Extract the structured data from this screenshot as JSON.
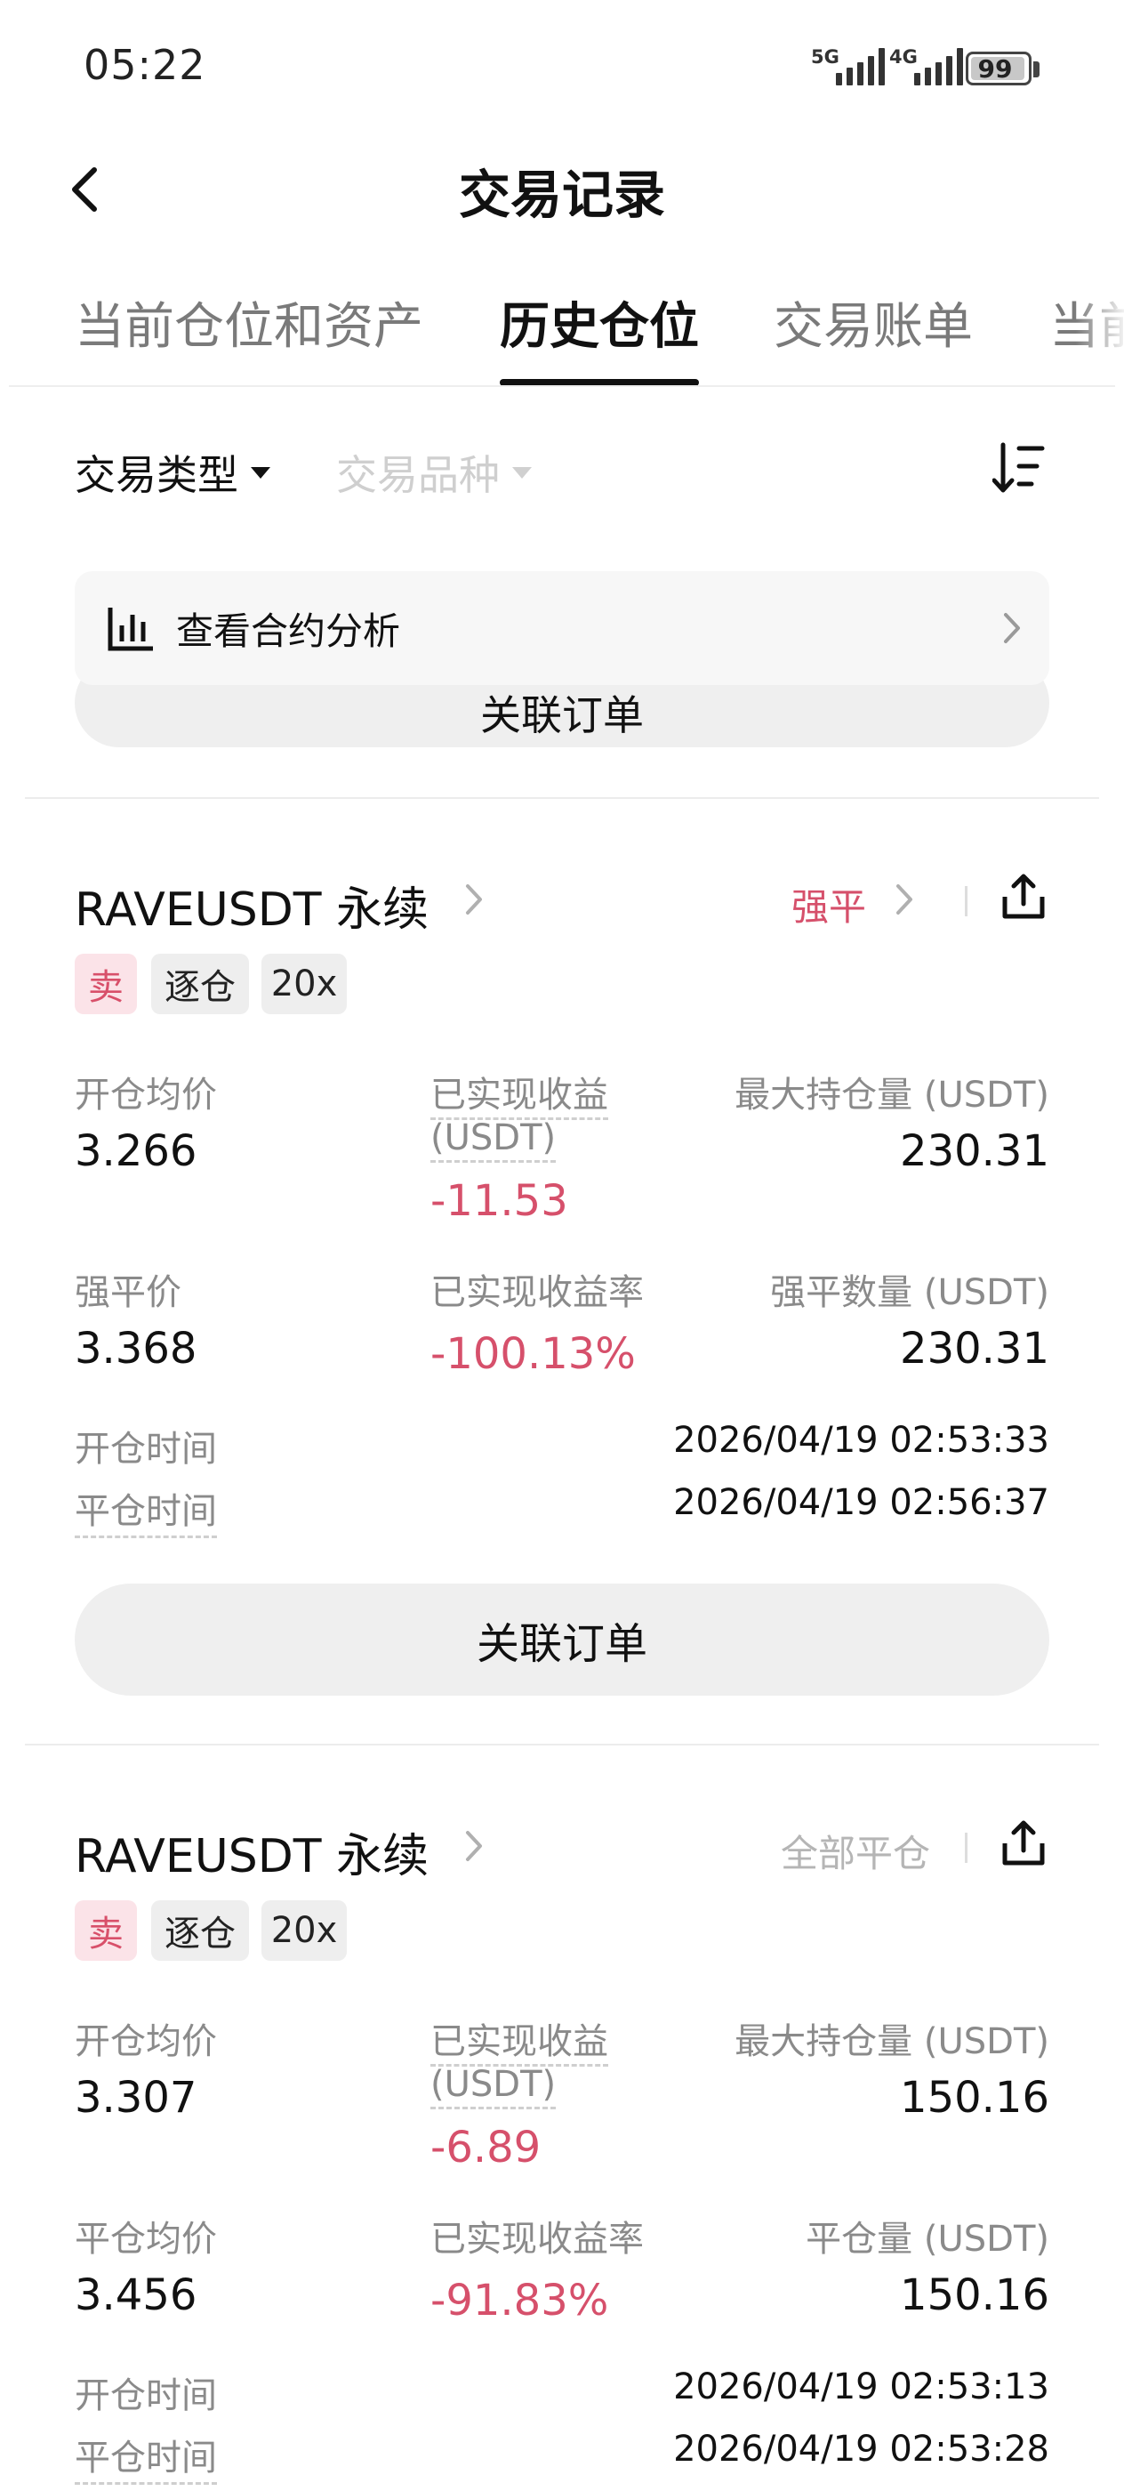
{
  "status_bar": {
    "time": "05:22",
    "network1": "5G",
    "network2": "4G",
    "battery": "99"
  },
  "header": {
    "title": "交易记录",
    "back_icon": "chevron-left-icon"
  },
  "tabs": [
    {
      "label": "当前仓位和资产",
      "active": false
    },
    {
      "label": "历史仓位",
      "active": true
    },
    {
      "label": "交易账单",
      "active": false
    },
    {
      "label": "当前",
      "active": false
    }
  ],
  "filters": {
    "trade_type": "交易类型",
    "trade_symbol": "交易品种",
    "sort_icon": "sort-icon"
  },
  "analysis": {
    "label": "查看合约分析",
    "icon": "bar-chart-icon"
  },
  "prev_card_button": "关联订单",
  "positions": [
    {
      "symbol": "RAVEUSDT 永续",
      "status": "强平",
      "status_color": "#d6506b",
      "tags": {
        "side": "卖",
        "margin": "逐仓",
        "leverage": "20x"
      },
      "fields": {
        "avg_open_label": "开仓均价",
        "avg_open": "3.266",
        "pnl_label": "已实现收益",
        "pnl_unit": "(USDT)",
        "pnl": "-11.53",
        "max_pos_label": "最大持仓量 (USDT)",
        "max_pos": "230.31",
        "row2_left_label": "强平价",
        "row2_left": "3.368",
        "roi_label": "已实现收益率",
        "roi": "-100.13%",
        "row2_right_label": "强平数量 (USDT)",
        "row2_right": "230.31"
      },
      "open_time_label": "开仓时间",
      "open_time": "2026/04/19 02:53:33",
      "close_time_label": "平仓时间",
      "close_time": "2026/04/19 02:56:37",
      "button": "关联订单"
    },
    {
      "symbol": "RAVEUSDT 永续",
      "status": "全部平仓",
      "status_color": "#b5b5b5",
      "tags": {
        "side": "卖",
        "margin": "逐仓",
        "leverage": "20x"
      },
      "fields": {
        "avg_open_label": "开仓均价",
        "avg_open": "3.307",
        "pnl_label": "已实现收益",
        "pnl_unit": "(USDT)",
        "pnl": "-6.89",
        "max_pos_label": "最大持仓量 (USDT)",
        "max_pos": "150.16",
        "row2_left_label": "平仓均价",
        "row2_left": "3.456",
        "roi_label": "已实现收益率",
        "roi": "-91.83%",
        "row2_right_label": "平仓量 (USDT)",
        "row2_right": "150.16"
      },
      "open_time_label": "开仓时间",
      "open_time": "2026/04/19 02:53:13",
      "close_time_label": "平仓时间",
      "close_time": "2026/04/19 02:53:28"
    }
  ]
}
